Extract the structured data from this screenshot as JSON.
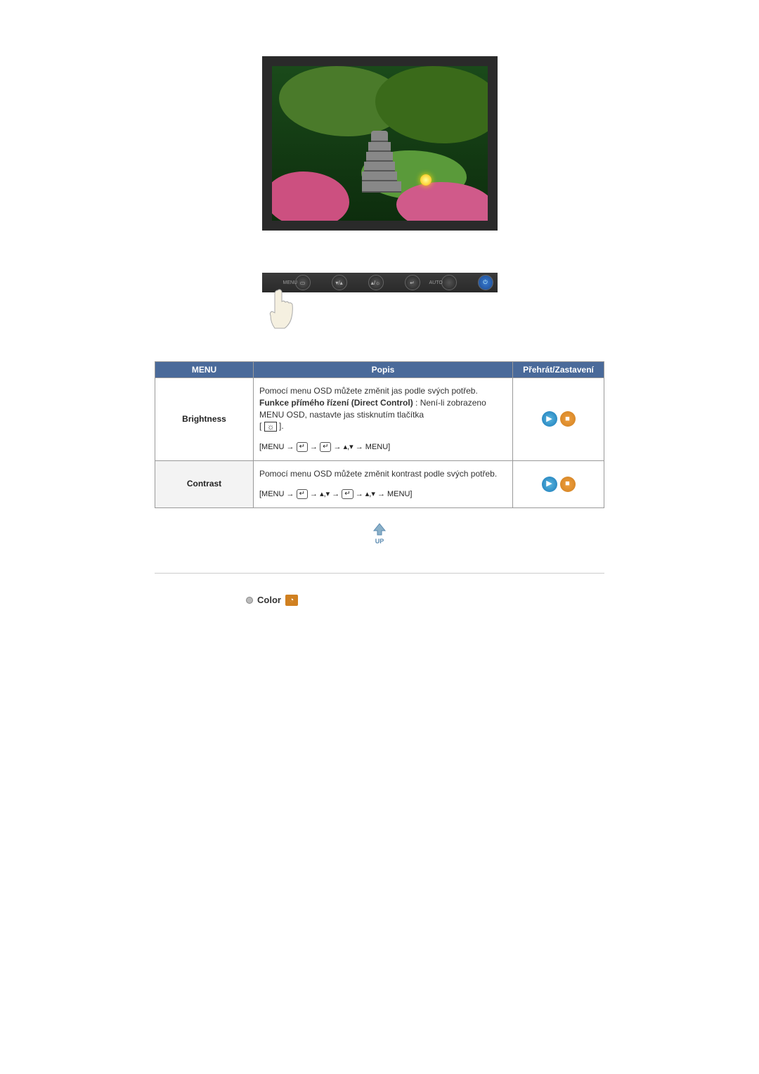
{
  "monitor_buttons": {
    "menu": "MENU",
    "down_up": "▾/▴",
    "bright": "▴/☼",
    "enter": "↵",
    "auto": "AUTO",
    "power": "⏻"
  },
  "table": {
    "headers": {
      "menu": "MENU",
      "desc": "Popis",
      "play": "Přehrát/Zastavení"
    },
    "rows": [
      {
        "menu": "Brightness",
        "desc_line1": "Pomocí menu OSD můžete změnit jas podle svých potřeb.",
        "direct_bold": "Funkce přímého řízení (Direct Control)",
        "direct_rest": " : Není-li zobrazeno MENU OSD, nastavte jas stisknutím tlačítka",
        "bracket_open": "[ ",
        "bracket_close": " ].",
        "nav": "[MENU → ↵ → ↵ → ▴,▾ → MENU]"
      },
      {
        "menu": "Contrast",
        "desc_line1": "Pomocí menu OSD můžete změnit kontrast podle svých potřeb.",
        "nav": "[MENU → ↵ → ▴,▾ → ↵ → ▴,▾ → MENU]"
      }
    ]
  },
  "up_label": "UP",
  "section": {
    "title": "Color",
    "badge": "◔"
  }
}
